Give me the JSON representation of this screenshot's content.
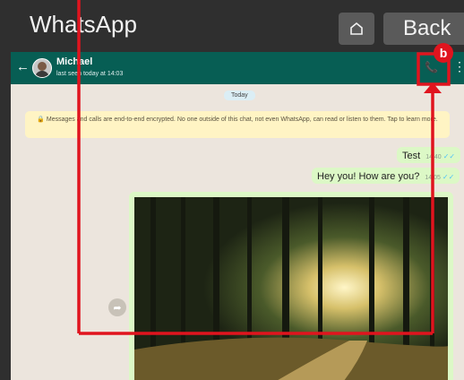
{
  "titlebar": {
    "app_title": "WhatsApp",
    "back_label": "Back"
  },
  "chat_header": {
    "contact_name": "Michael",
    "last_seen": "last seen today at 14:03"
  },
  "date_chip": "Today",
  "encryption_notice": "Messages and calls are end-to-end encrypted. No one outside of this chat, not even WhatsApp, can read or listen to them. Tap to learn more.",
  "messages": [
    {
      "text": "Test",
      "time": "14:40"
    },
    {
      "text": "Hey you! How are you?",
      "time": "14:05"
    }
  ],
  "annotation": {
    "badge": "b"
  },
  "colors": {
    "header": "#075e54",
    "outgoing_bubble": "#dcf8c6",
    "annotation_red": "#e0141e"
  }
}
